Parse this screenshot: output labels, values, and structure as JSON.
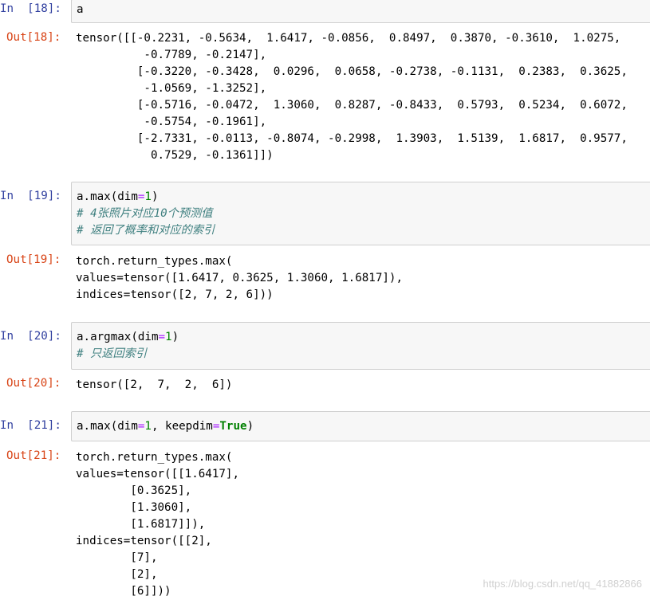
{
  "cells": [
    {
      "in_prompt": "In  [18]:",
      "input_lines": [
        "a"
      ],
      "out_prompt": "Out[18]:",
      "output_lines": [
        "tensor([[-0.2231, -0.5634,  1.6417, -0.0856,  0.8497,  0.3870, -0.3610,  1.0275,",
        "          -0.7789, -0.2147],",
        "         [-0.3220, -0.3428,  0.0296,  0.0658, -0.2738, -0.1131,  0.2383,  0.3625,",
        "          -1.0569, -1.3252],",
        "         [-0.5716, -0.0472,  1.3060,  0.8287, -0.8433,  0.5793,  0.5234,  0.6072,",
        "          -0.5754, -0.1961],",
        "         [-2.7331, -0.0113, -0.8074, -0.2998,  1.3903,  1.5139,  1.6817,  0.9577,",
        "           0.7529, -0.1361]])"
      ]
    },
    {
      "in_prompt": "In  [19]:",
      "input_code": "a.max(dim=1)",
      "input_comments": [
        "# 4张照片对应10个预测值",
        "# 返回了概率和对应的索引"
      ],
      "out_prompt": "Out[19]:",
      "output_lines": [
        "torch.return_types.max(",
        "values=tensor([1.6417, 0.3625, 1.3060, 1.6817]),",
        "indices=tensor([2, 7, 2, 6]))"
      ]
    },
    {
      "in_prompt": "In  [20]:",
      "input_code": "a.argmax(dim=1)",
      "input_comments": [
        "# 只返回索引"
      ],
      "out_prompt": "Out[20]:",
      "output_lines": [
        "tensor([2,  7,  2,  6])"
      ]
    },
    {
      "in_prompt": "In  [21]:",
      "input_code": "a.max(dim=1, keepdim=True)",
      "out_prompt": "Out[21]:",
      "output_lines": [
        "torch.return_types.max(",
        "values=tensor([[1.6417],",
        "        [0.3625],",
        "        [1.3060],",
        "        [1.6817]]),",
        "indices=tensor([[2],",
        "        [7],",
        "        [2],",
        "        [6]]))"
      ]
    }
  ],
  "watermark": "https://blog.csdn.net/qq_41882866",
  "colors": {
    "in_prompt": "#303f9f",
    "out_prompt": "#d84315",
    "comment": "#408080",
    "keyword": "#008000",
    "cell_bg": "#f7f7f7",
    "cell_border": "#cfcfcf"
  }
}
